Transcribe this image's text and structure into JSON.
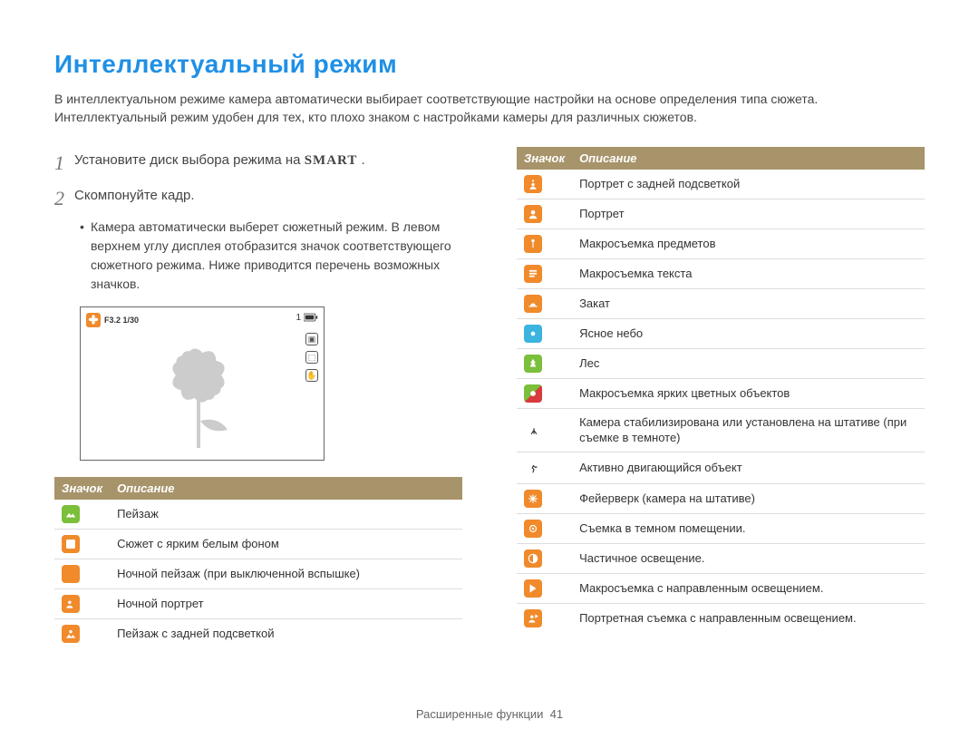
{
  "title": "Интеллектуальный режим",
  "intro": "В интеллектуальном режиме камера автоматически выбирает соответствующие настройки на основе определения типа сюжета. Интеллектуальный режим удобен для тех, кто плохо знаком с настройками камеры для различных сюжетов.",
  "steps": {
    "s1_pre": "Установите диск выбора режима на ",
    "s1_smart": "SMART",
    "s1_post": " .",
    "s2": "Скомпонуйте кадр.",
    "s2_sub": "Камера автоматически выберет сюжетный режим. В левом верхнем углу дисплея отобразится значок соответствующего сюжетного режима. Ниже приводится перечень возможных значков."
  },
  "display": {
    "top_left_label": "F3.2 1/30",
    "top_right_count": "1"
  },
  "table_header": {
    "icon": "Значок",
    "desc": "Описание"
  },
  "left_rows": [
    {
      "icon": "landscape",
      "style": "green",
      "desc": "Пейзаж"
    },
    {
      "icon": "white-bg",
      "style": "orange",
      "desc": "Сюжет с ярким белым фоном"
    },
    {
      "icon": "night",
      "style": "orange",
      "desc": "Ночной пейзаж (при выключенной вспышке)"
    },
    {
      "icon": "night-portrait",
      "style": "orange",
      "desc": "Ночной портрет"
    },
    {
      "icon": "backlight-land",
      "style": "orange",
      "desc": "Пейзаж с задней подсветкой"
    }
  ],
  "right_rows": [
    {
      "icon": "backlight-port",
      "style": "orange",
      "desc": "Портрет с задней подсветкой"
    },
    {
      "icon": "portrait",
      "style": "orange",
      "desc": "Портрет"
    },
    {
      "icon": "macro",
      "style": "orange",
      "desc": "Макросъемка предметов"
    },
    {
      "icon": "macro-text",
      "style": "orange",
      "desc": "Макросъемка текста"
    },
    {
      "icon": "sunset",
      "style": "orange",
      "desc": "Закат"
    },
    {
      "icon": "clear-sky",
      "style": "cyan",
      "desc": "Ясное небо"
    },
    {
      "icon": "forest",
      "style": "green",
      "desc": "Лес"
    },
    {
      "icon": "macro-color",
      "style": "greenred",
      "desc": "Макросъемка ярких цветных объектов"
    },
    {
      "icon": "tripod",
      "style": "black",
      "desc": "Камера стабилизирована или установлена на штативе (при съемке в темноте)"
    },
    {
      "icon": "action",
      "style": "black",
      "desc": "Активно двигающийся объект"
    },
    {
      "icon": "fireworks",
      "style": "orange",
      "desc": "Фейерверк (камера на штативе)"
    },
    {
      "icon": "dark-room",
      "style": "orange",
      "desc": "Съемка в темном помещении."
    },
    {
      "icon": "partial-light",
      "style": "orange",
      "desc": "Частичное освещение."
    },
    {
      "icon": "macro-spot",
      "style": "orange",
      "desc": "Макросъемка с направленным освещением."
    },
    {
      "icon": "portrait-spot",
      "style": "orange",
      "desc": "Портретная съемка с направленным освещением."
    }
  ],
  "footer": {
    "text": "Расширенные функции",
    "page": "41"
  }
}
